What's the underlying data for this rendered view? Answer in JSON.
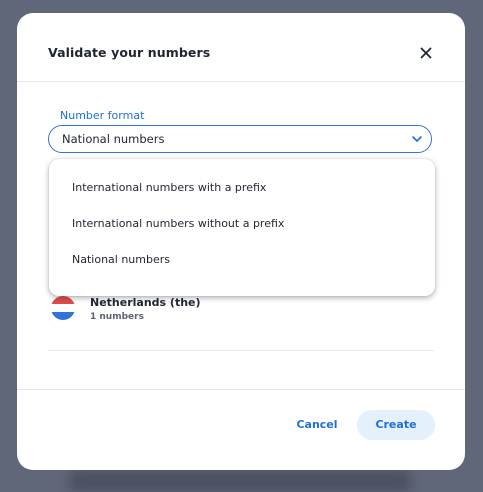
{
  "modal": {
    "title": "Validate your numbers"
  },
  "number_format": {
    "label": "Number format",
    "selected_value": "National numbers",
    "options": [
      "International numbers with a prefix",
      "International numbers without a prefix",
      "National numbers"
    ]
  },
  "country": {
    "name": "Netherlands (the)",
    "count": "1 numbers",
    "flag_colors": [
      "#e14b4b",
      "#ffffff",
      "#2f74d6"
    ]
  },
  "footer": {
    "cancel_label": "Cancel",
    "create_label": "Create"
  },
  "colors": {
    "accent": "#1f6fd8",
    "primary_button_bg": "#e5f0fd",
    "backdrop": "#606778"
  },
  "icons": {
    "close": "close-icon",
    "chevron": "chevron-down-icon",
    "flag": "netherlands-flag-icon"
  }
}
